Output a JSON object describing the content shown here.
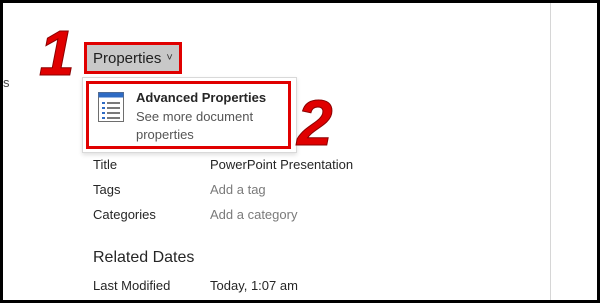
{
  "annotations": {
    "step1": "1",
    "step2": "2"
  },
  "edge_text": "s",
  "properties_button": {
    "label": "Properties",
    "chevron": "˅"
  },
  "dropdown": {
    "item": {
      "title": "Advanced Properties",
      "description": "See more document properties",
      "icon": "document-properties-icon"
    }
  },
  "properties": [
    {
      "label": "Title",
      "value": "PowerPoint Presentation",
      "placeholder": false
    },
    {
      "label": "Tags",
      "value": "Add a tag",
      "placeholder": true
    },
    {
      "label": "Categories",
      "value": "Add a category",
      "placeholder": true
    }
  ],
  "related_dates": {
    "heading": "Related Dates",
    "items": [
      {
        "label": "Last Modified",
        "value": "Today, 1:07 am"
      }
    ]
  },
  "colors": {
    "highlight_red": "#e00000",
    "button_bg": "#c8c8c8",
    "placeholder_text": "#7a7a7a"
  }
}
